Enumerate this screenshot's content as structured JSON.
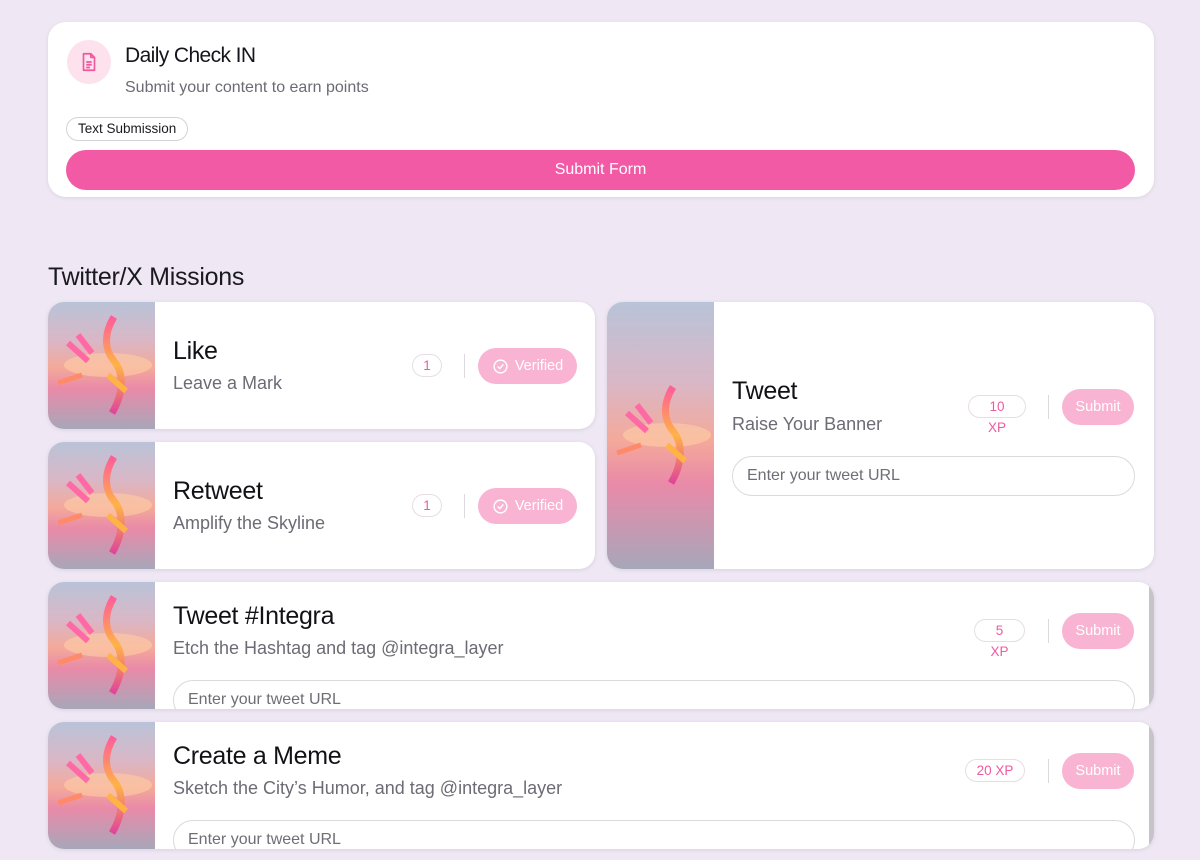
{
  "checkin": {
    "title": "Daily Check IN",
    "subtitle": "Submit your content to earn points",
    "chip": "Text Submission",
    "submit_label": "Submit Form",
    "icon": "document-icon"
  },
  "section_title": "Twitter/X Missions",
  "missions": {
    "like": {
      "title": "Like",
      "subtitle": "Leave a Mark",
      "count": "1",
      "status_label": "Verified"
    },
    "retweet": {
      "title": "Retweet",
      "subtitle": "Amplify the Skyline",
      "count": "1",
      "status_label": "Verified"
    },
    "tweet": {
      "title": "Tweet",
      "subtitle": "Raise Your Banner",
      "xp": "10 XP",
      "submit_label": "Submit",
      "placeholder": "Enter your tweet URL"
    },
    "tweet_integra": {
      "title": "Tweet #Integra",
      "subtitle": "Etch the Hashtag and tag @integra_layer",
      "xp": "5 XP",
      "submit_label": "Submit",
      "placeholder": "Enter your tweet URL"
    },
    "meme": {
      "title": "Create a Meme",
      "subtitle": "Sketch the City’s Humor, and tag @integra_layer",
      "xp": "20 XP",
      "submit_label": "Submit",
      "placeholder": "Enter your tweet URL"
    }
  },
  "colors": {
    "accent": "#f25aa5",
    "accent_soft": "#f8b4d2",
    "background": "#efe8f4"
  }
}
